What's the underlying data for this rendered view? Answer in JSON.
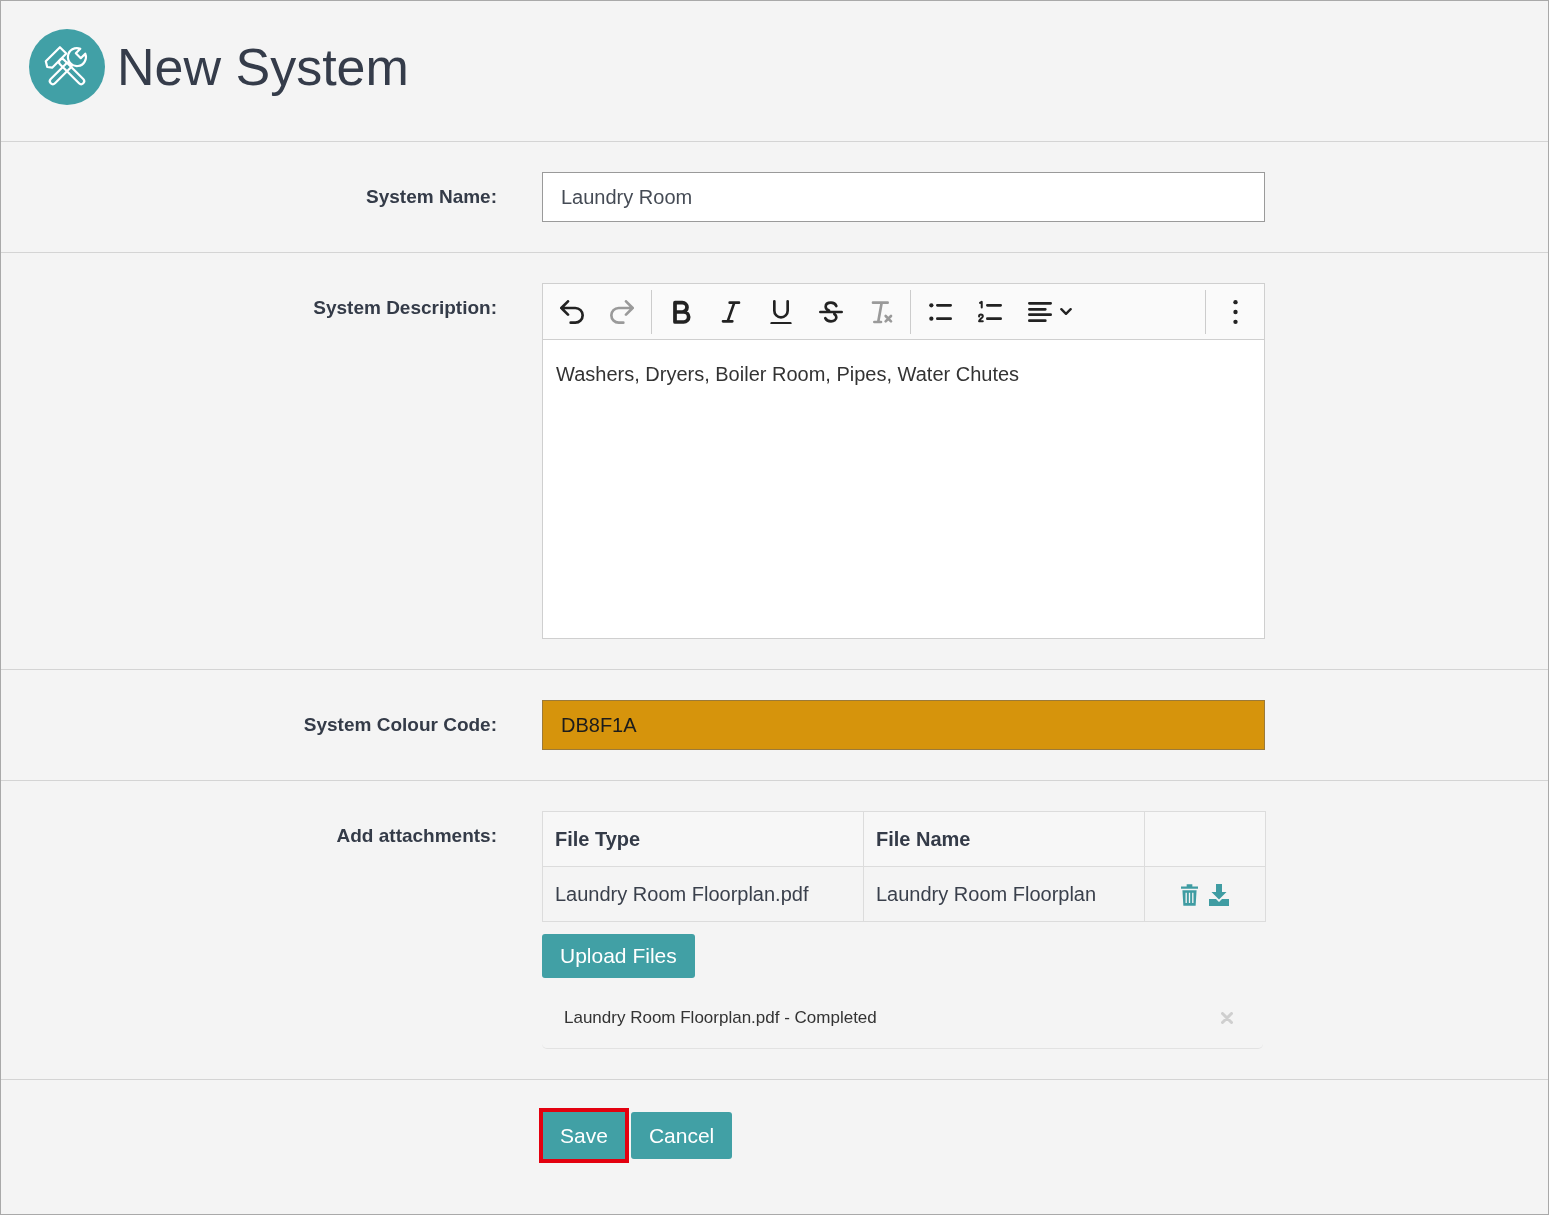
{
  "header": {
    "title": "New System"
  },
  "system_name": {
    "label": "System Name:",
    "value": "Laundry Room"
  },
  "system_description": {
    "label": "System Description:",
    "toolbar": [
      {
        "items": [
          {
            "kind": "undo",
            "disabled": false
          },
          {
            "kind": "redo",
            "disabled": true
          }
        ]
      },
      {
        "items": [
          {
            "kind": "bold",
            "disabled": false
          },
          {
            "kind": "italic",
            "disabled": false
          },
          {
            "kind": "underline",
            "disabled": false
          },
          {
            "kind": "strikethrough",
            "disabled": false
          },
          {
            "kind": "clear_format",
            "disabled": true
          }
        ]
      },
      {
        "items": [
          {
            "kind": "bullet_list",
            "disabled": false
          },
          {
            "kind": "numbered_list",
            "disabled": false
          },
          {
            "kind": "align",
            "disabled": false
          }
        ]
      },
      {
        "items": [
          {
            "kind": "more",
            "disabled": false
          }
        ]
      }
    ],
    "value": "Washers, Dryers, Boiler Room, Pipes, Water Chutes"
  },
  "colour_code": {
    "label": "System Colour Code:",
    "value": "DB8F1A",
    "color": "#d6940c"
  },
  "attachments": {
    "label": "Add attachments:",
    "columns": [
      "File Type",
      "File Name"
    ],
    "rows": [
      {
        "file_type": "Laundry Room Floorplan.pdf",
        "file_name": "Laundry Room Floorplan"
      }
    ],
    "upload_button": "Upload Files",
    "uploads": [
      {
        "text": "Laundry Room Floorplan.pdf - Completed"
      }
    ]
  },
  "actions": [
    {
      "label": "Save",
      "highlighted": true
    },
    {
      "label": "Cancel",
      "highlighted": false
    }
  ]
}
